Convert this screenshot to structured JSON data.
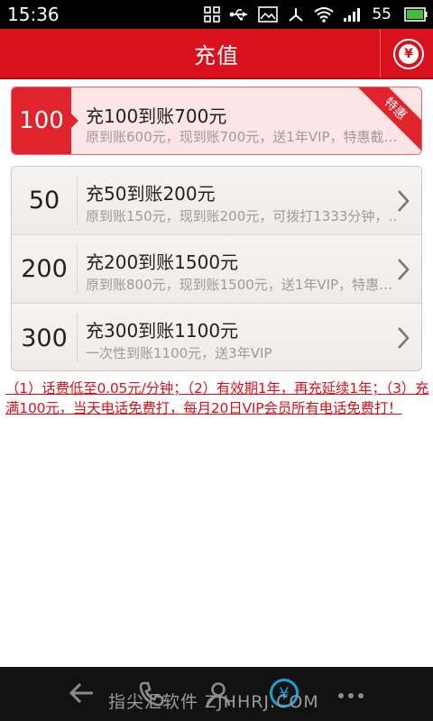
{
  "status_bar": {
    "time": "15:36",
    "battery": "55"
  },
  "header": {
    "title": "充值"
  },
  "featured": {
    "amount": "100",
    "title": "充100到账700元",
    "subtitle": "原到账600元，现到账700元，送1年VIP，特惠截…",
    "ribbon": "特惠"
  },
  "packages": [
    {
      "amount": "50",
      "title": "充50到账200元",
      "subtitle": "原到账150元，现到账200元，可拨打1333分钟，…"
    },
    {
      "amount": "200",
      "title": "充200到账1500元",
      "subtitle": "原到账800元，现到账1500元，送1年VIP，特惠…"
    },
    {
      "amount": "300",
      "title": "充300到账1100元",
      "subtitle": "一次性到账1100元，送3年VIP"
    }
  ],
  "notes": "（1）话费低至0.05元/分钟；（2）有效期1年，再充延续1年；（3）充满100元，当天电话免费打，每月20日VIP会员所有电话免费打！",
  "watermark": "指尖汇软件 ZJHHRJ.COM",
  "colors": {
    "brand_red": "#d8111c",
    "accent_blue": "#1a9fd8"
  },
  "icons": {
    "status": [
      "screenshot-icon",
      "usb-icon",
      "image-icon",
      "network-icon",
      "wifi-icon",
      "signal-icon",
      "battery-icon"
    ],
    "header": "yuan-icon",
    "nav": [
      "back-icon",
      "call-icon",
      "contacts-icon",
      "recharge-icon",
      "more-icon"
    ]
  }
}
